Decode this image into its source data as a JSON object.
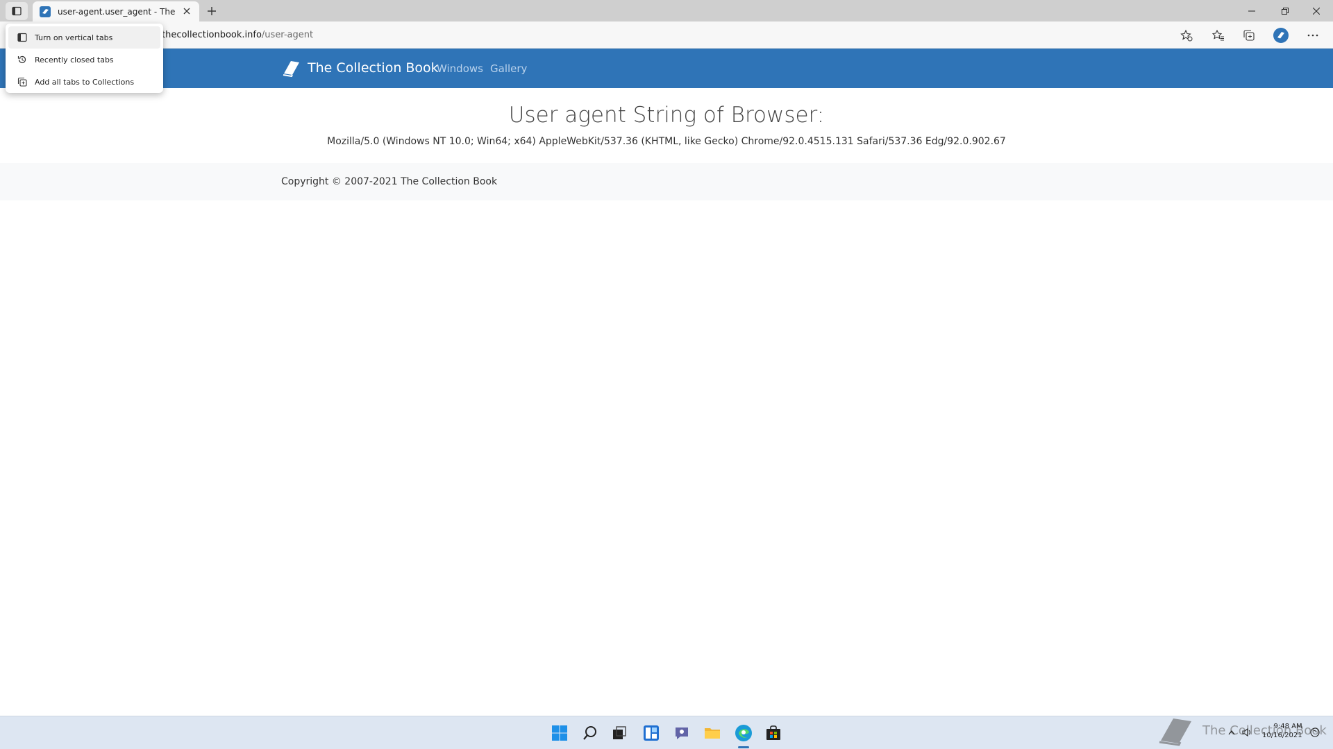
{
  "browser": {
    "tab": {
      "title": "user-agent.user_agent - The Collection Book"
    },
    "address_bar": {
      "host": "thecollectionbook.info",
      "path": "/user-agent"
    },
    "tab_actions_menu": {
      "items": [
        {
          "label": "Turn on vertical tabs",
          "icon": "vertical-tabs-icon"
        },
        {
          "label": "Recently closed tabs",
          "icon": "history-icon"
        },
        {
          "label": "Add all tabs to Collections",
          "icon": "collections-icon"
        }
      ]
    }
  },
  "site": {
    "brand": "The Collection Book",
    "nav": [
      {
        "label": "Windows"
      },
      {
        "label": "Gallery"
      }
    ],
    "heading": "User agent String of Browser:",
    "user_agent": "Mozilla/5.0 (Windows NT 10.0; Win64; x64) AppleWebKit/537.36 (KHTML, like Gecko) Chrome/92.0.4515.131 Safari/537.36 Edg/92.0.902.67",
    "footer": "Copyright © 2007-2021 The Collection Book",
    "brand_color": "#2f74b7"
  },
  "taskbar": {
    "watermark": "The Collection Book",
    "clock": {
      "time": "9:48 AM",
      "date": "10/16/2021"
    }
  }
}
